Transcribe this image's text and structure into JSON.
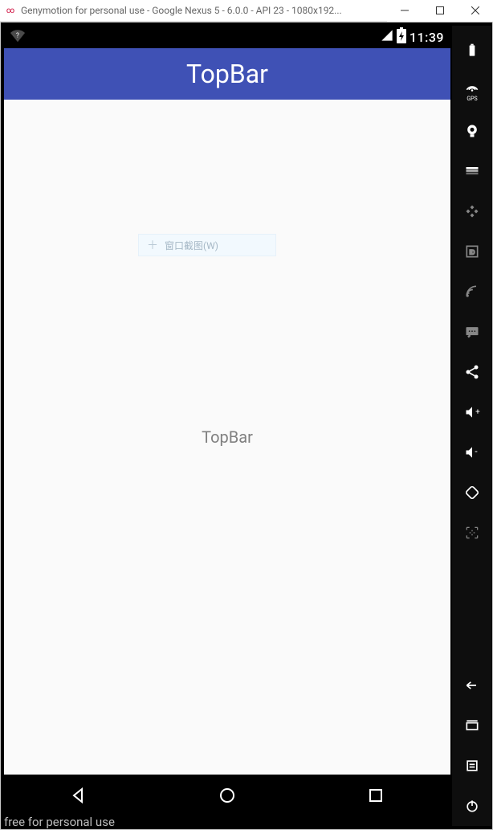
{
  "window": {
    "title": "Genymotion for personal use - Google Nexus 5 - 6.0.0 - API 23 - 1080x192..."
  },
  "statusbar": {
    "time": "11:39"
  },
  "appbar": {
    "title": "TopBar"
  },
  "content": {
    "center_text": "TopBar",
    "ghost_menu_text": "窗口截图(W)"
  },
  "watermark": "free for personal use",
  "sidebar": {
    "gps_label": "GPS"
  }
}
